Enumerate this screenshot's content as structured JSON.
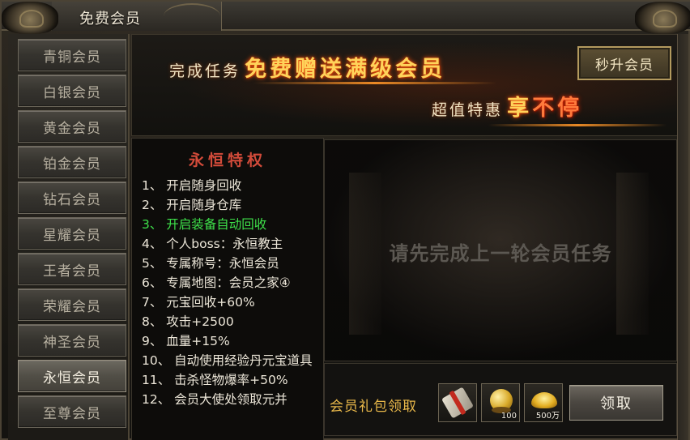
{
  "window": {
    "title": "免费会员"
  },
  "sidebar": {
    "active_index": 9,
    "items": [
      {
        "label": "青铜会员"
      },
      {
        "label": "白银会员"
      },
      {
        "label": "黄金会员"
      },
      {
        "label": "铂金会员"
      },
      {
        "label": "钻石会员"
      },
      {
        "label": "星耀会员"
      },
      {
        "label": "王者会员"
      },
      {
        "label": "荣耀会员"
      },
      {
        "label": "神圣会员"
      },
      {
        "label": "永恒会员"
      },
      {
        "label": "至尊会员"
      }
    ]
  },
  "banner": {
    "line1_small": "完成任务",
    "line1_big": "免费赠送满级会员",
    "line2_small": "超值特惠",
    "line2_big_a": "享",
    "line2_big_b": "不停",
    "rush_button": "秒升会员"
  },
  "privileges": {
    "title": "永恒特权",
    "items": [
      "1、 开启随身回收",
      "2、 开启随身仓库",
      "3、 开启装备自动回收",
      "4、 个人boss：永恒教主",
      "5、 专属称号：永恒会员",
      "6、 专属地图：会员之家④",
      "7、 元宝回收+60%",
      "8、 攻击+2500",
      "9、 血量+15%",
      "10、 自动使用经验丹元宝道具",
      "11、 击杀怪物爆率+50%",
      "12、 会员大使处领取元并"
    ],
    "highlight_index": 2
  },
  "preview": {
    "message": "请先完成上一轮会员任务"
  },
  "gift": {
    "label": "会员礼包领取",
    "slots": [
      {
        "icon": "scroll-icon",
        "qty": ""
      },
      {
        "icon": "gold-orb-icon",
        "qty": "100"
      },
      {
        "icon": "gold-ingot-icon",
        "qty": "500万"
      }
    ],
    "claim_button": "领取"
  },
  "colors": {
    "accent_gold": "#ffd35a",
    "highlight_green": "#3ee04a",
    "privilege_title_red": "#d24b3a",
    "gift_label_gold": "#e9b84a"
  }
}
